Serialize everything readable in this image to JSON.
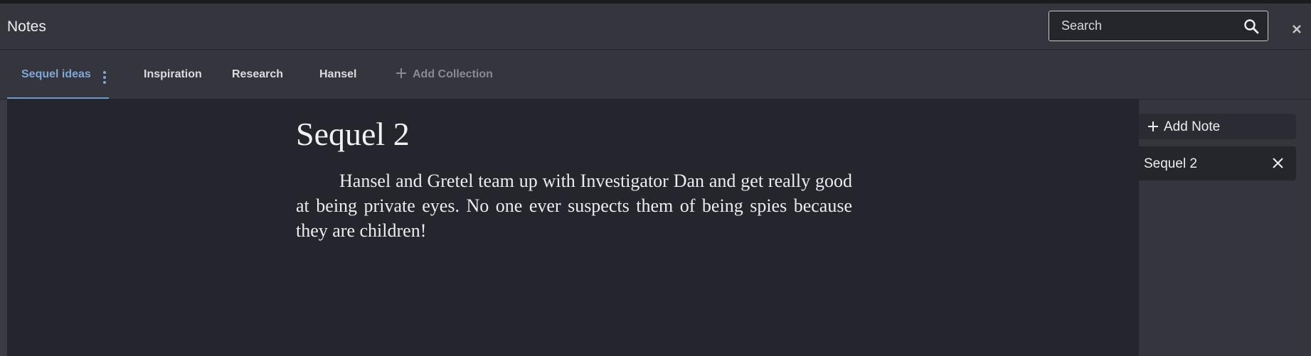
{
  "app": {
    "title": "Notes"
  },
  "search": {
    "placeholder": "Search"
  },
  "tabs": [
    {
      "label": "Sequel ideas",
      "active": true
    },
    {
      "label": "Inspiration",
      "active": false
    },
    {
      "label": "Research",
      "active": false
    },
    {
      "label": "Hansel",
      "active": false
    }
  ],
  "add_collection_label": "Add Collection",
  "note": {
    "title": "Sequel 2",
    "body": "Hansel and Gretel team up with Investigator Dan and get really good at being private eyes. No one ever suspects them of being spies because they are children!"
  },
  "sidebar": {
    "add_note_label": "Add Note",
    "notes": [
      {
        "label": "Sequel 2"
      }
    ]
  },
  "colors": {
    "accent": "#7fa7d8",
    "header_bg": "#34353d",
    "editor_bg": "#24252d"
  },
  "icons": {
    "search": "search-icon",
    "close": "close-icon",
    "tab_menu": "kebab-menu-icon",
    "add": "plus-icon",
    "remove_note": "x-icon"
  }
}
